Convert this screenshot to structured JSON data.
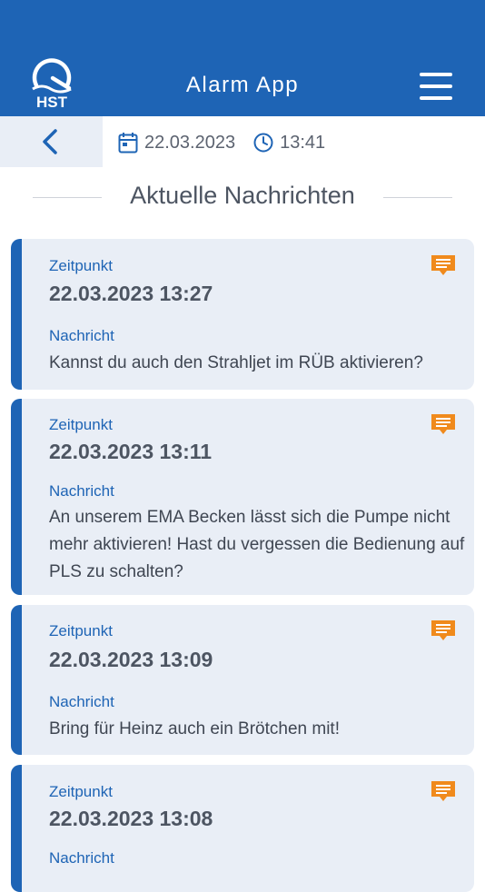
{
  "header": {
    "logo_text": "HST",
    "title": "Alarm App",
    "menu_icon": "hamburger-menu-icon"
  },
  "subbar": {
    "back_icon": "chevron-left-icon",
    "date_icon": "calendar-icon",
    "date": "22.03.2023",
    "time_icon": "clock-icon",
    "time": "13:41"
  },
  "section": {
    "title": "Aktuelle Nachrichten"
  },
  "messages": [
    {
      "time_label": "Zeitpunkt",
      "timestamp": "22.03.2023 13:27",
      "message_label": "Nachricht",
      "message": "Kannst du auch den Strahljet im RÜB aktivieren?",
      "icon": "message-icon"
    },
    {
      "time_label": "Zeitpunkt",
      "timestamp": "22.03.2023 13:11",
      "message_label": "Nachricht",
      "message": "An unserem EMA Becken lässt sich die Pumpe nicht mehr aktivieren! Hast du vergessen die Bedienung auf PLS zu schalten?",
      "icon": "message-icon"
    },
    {
      "time_label": "Zeitpunkt",
      "timestamp": "22.03.2023 13:09",
      "message_label": "Nachricht",
      "message": "Bring für Heinz auch ein Brötchen mit!",
      "icon": "message-icon"
    },
    {
      "time_label": "Zeitpunkt",
      "timestamp": "22.03.2023 13:08",
      "message_label": "Nachricht",
      "message": "",
      "icon": "message-icon"
    }
  ],
  "colors": {
    "primary": "#1e64b5",
    "card_background": "#e9eef6",
    "accent_icon": "#f08a1c",
    "text_dark": "#4d5562"
  }
}
